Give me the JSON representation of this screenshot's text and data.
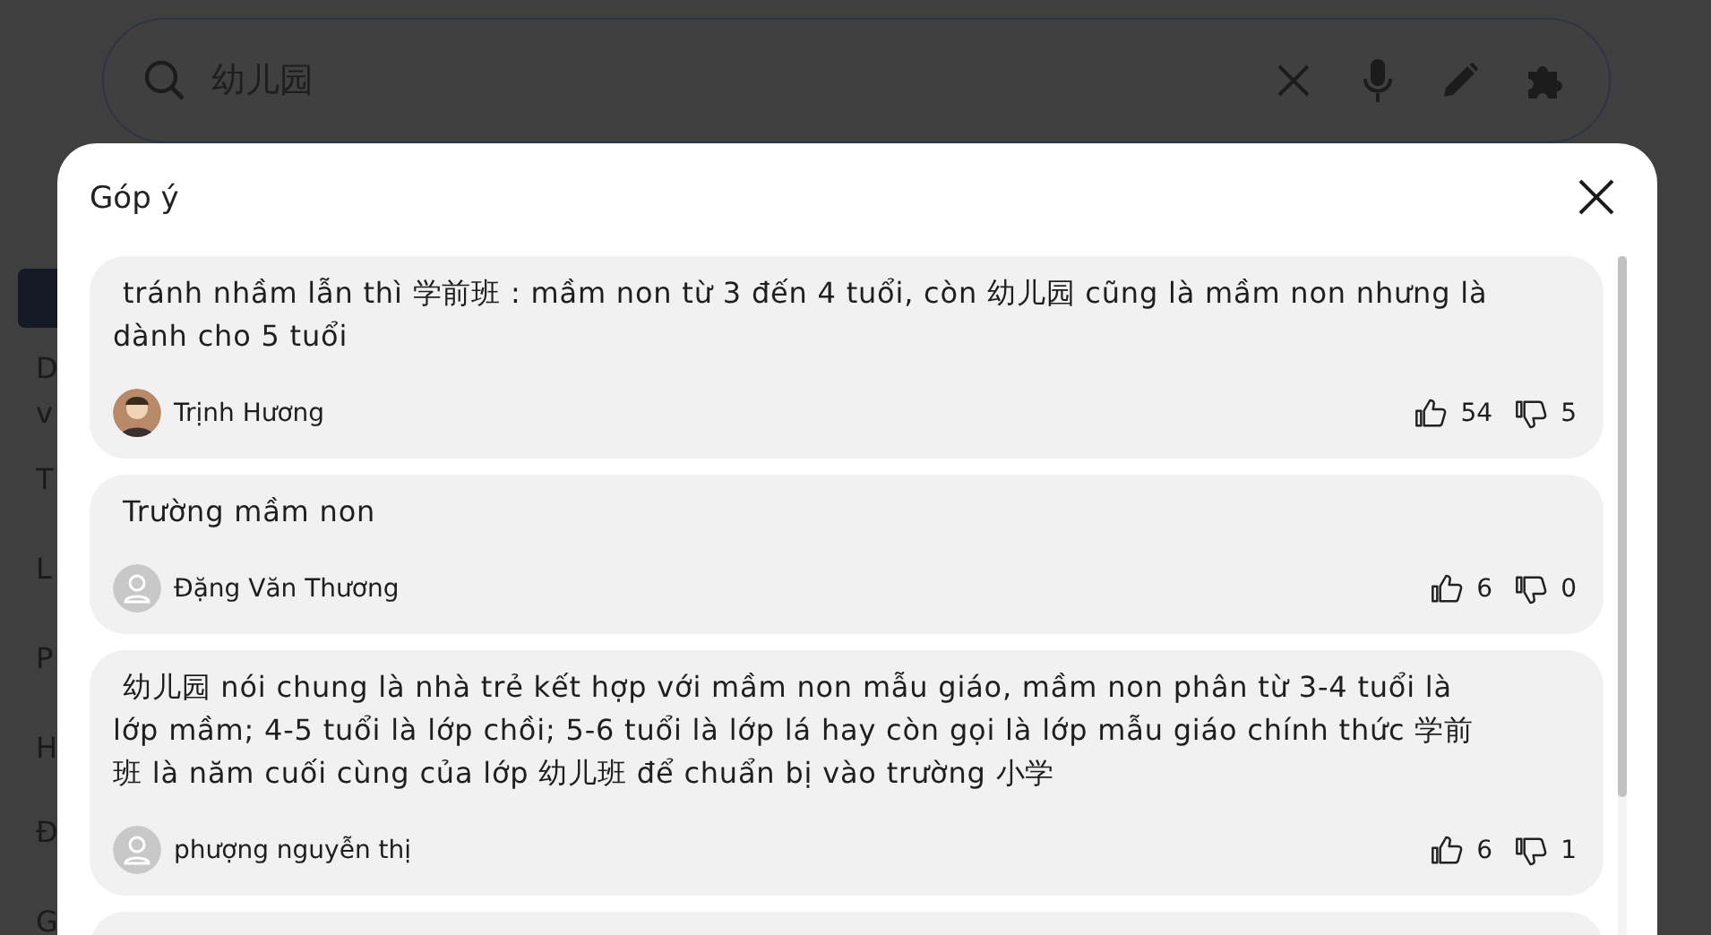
{
  "search": {
    "value": "幼儿园"
  },
  "background_fragments": [
    "D",
    "v",
    "T",
    "L",
    "P",
    "H",
    "Đ",
    "G"
  ],
  "dialog": {
    "title": "Góp ý",
    "comments": [
      {
        "text": " tránh nhầm lẫn thì 学前班 : mầm non từ 3 đến 4 tuổi, còn 幼儿园 cũng là mầm non nhưng là dành cho 5 tuổi",
        "author": "Trịnh Hương",
        "avatar": {
          "kind": "photo"
        },
        "likes": "54",
        "dislikes": "5"
      },
      {
        "text": " Trường mầm non",
        "author": "Đặng Văn Thương",
        "avatar": {
          "kind": "default"
        },
        "likes": "6",
        "dislikes": "0"
      },
      {
        "text": " 幼儿园 nói chung là nhà trẻ kết hợp với mầm non mẫu giáo, mầm non phân từ 3-4 tuổi là lớp mầm; 4-5 tuổi là lớp chồi; 5-6 tuổi là lớp lá hay còn gọi là lớp mẫu giáo chính thức 学前班 là năm cuối cùng của lớp 幼儿班 để chuẩn bị vào trường 小学",
        "author": "phượng nguyễn thị",
        "avatar": {
          "kind": "default"
        },
        "likes": "6",
        "dislikes": "1"
      }
    ]
  }
}
